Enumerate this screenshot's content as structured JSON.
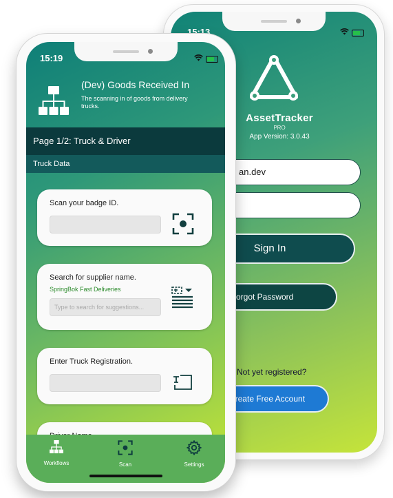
{
  "back_phone": {
    "status_time": "15:13",
    "app_name": "AssetTracker",
    "app_tier": "PRO",
    "app_version": "App Version: 3.0.43",
    "username_value": "an.dev",
    "password_value": "",
    "sign_in_label": "Sign In",
    "forgot_password_label": "Forgot Password",
    "not_registered_text": "Not yet registered?",
    "create_account_label": "Create Free Account"
  },
  "front_phone": {
    "status_time": "15:19",
    "header": {
      "title": "(Dev) Goods Received In",
      "description": "The scanning in of goods from delivery trucks."
    },
    "page_title": "Page 1/2: Truck & Driver",
    "section_title": "Truck Data",
    "cards": {
      "badge": {
        "label": "Scan your badge ID.",
        "value": ""
      },
      "supplier": {
        "label": "Search for supplier name.",
        "selected": "SpringBok Fast Deliveries",
        "placeholder": "Type to search for suggestions..."
      },
      "registration": {
        "label": "Enter Truck Registration.",
        "value": ""
      },
      "driver": {
        "label": "Driver Name"
      }
    },
    "tabs": [
      {
        "label": "Workflows",
        "icon": "workflows-icon"
      },
      {
        "label": "Scan",
        "icon": "scan-icon"
      },
      {
        "label": "Settings",
        "icon": "gear-icon"
      }
    ]
  },
  "colors": {
    "gradient_start": "#0f7f78",
    "gradient_end": "#b3dc3e",
    "dark_teal": "#0b3a3d",
    "button_blue": "#1e7ad4",
    "tabbar": "#5aae59"
  }
}
